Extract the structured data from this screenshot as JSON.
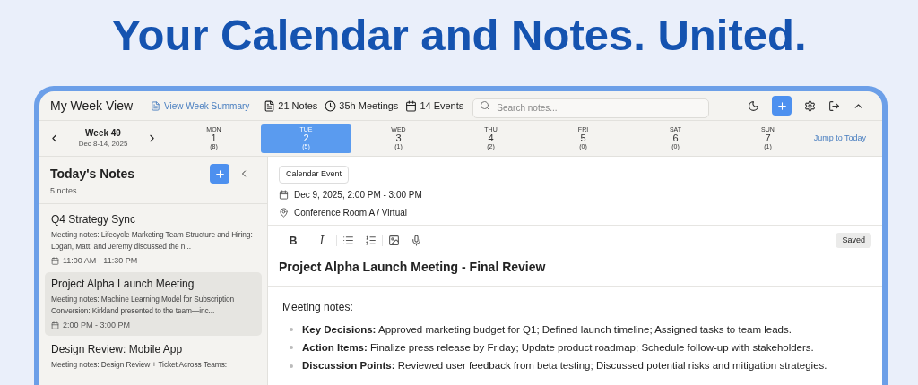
{
  "headline": "Your Calendar and Notes. United.",
  "window": {
    "title": "My Week View",
    "summary_link": "View Week Summary",
    "stats": [
      {
        "kind": "notes",
        "text": "21 Notes"
      },
      {
        "kind": "clock",
        "text": "35h Meetings"
      },
      {
        "kind": "calendar",
        "text": "14 Events"
      }
    ],
    "search": {
      "placeholder": "Search notes..."
    }
  },
  "week": {
    "label": "Week 49",
    "range": "Dec 8-14, 2025",
    "jump": "Jump to Today",
    "days": [
      {
        "dow": "MON",
        "date": "1",
        "count": "(8)",
        "selected": false
      },
      {
        "dow": "TUE",
        "date": "2",
        "count": "(5)",
        "selected": true
      },
      {
        "dow": "WED",
        "date": "3",
        "count": "(1)",
        "selected": false
      },
      {
        "dow": "THU",
        "date": "4",
        "count": "(2)",
        "selected": false
      },
      {
        "dow": "FRI",
        "date": "5",
        "count": "(0)",
        "selected": false
      },
      {
        "dow": "SAT",
        "date": "6",
        "count": "(0)",
        "selected": false
      },
      {
        "dow": "SUN",
        "date": "7",
        "count": "(1)",
        "selected": false
      }
    ]
  },
  "sidebar": {
    "title": "Today's Notes",
    "count": "5 notes",
    "notes": [
      {
        "title": "Q4 Strategy Sync",
        "preview": "Meeting notes: Lifecycle Marketing Team Structure and Hiring: Logan, Matt, and Jeremy discussed the n...",
        "time": "11:00 AM - 11:30 PM",
        "selected": false
      },
      {
        "title": "Project Alpha Launch Meeting",
        "preview": "Meeting notes: Machine Learning Model for Subscription Conversion: Kirkland presented to the team—inc...",
        "time": "2:00 PM - 3:00 PM",
        "selected": true
      },
      {
        "title": "Design Review: Mobile App",
        "preview": "Meeting notes: Design Review + Ticket Across Teams:",
        "selected": false
      }
    ]
  },
  "editor": {
    "badge": "Calendar Event",
    "date": "Dec 9, 2025, 2:00 PM - 3:00 PM",
    "location": "Conference Room A / Virtual",
    "toolbar": [
      [
        {
          "kind": "bold",
          "label": "B"
        },
        {
          "kind": "italic",
          "label": "I"
        }
      ],
      [
        {
          "kind": "bullets"
        },
        {
          "kind": "numbers"
        }
      ],
      [
        {
          "kind": "image"
        },
        {
          "kind": "mic"
        }
      ]
    ],
    "status": "Saved",
    "title": "Project Alpha Launch Meeting - Final Review",
    "intro": "Meeting notes:",
    "bullets": [
      "**Key Decisions:** Approved marketing budget for Q1; Defined launch timeline; Assigned tasks to team leads.",
      "**Action Items:** Finalize press release by Friday; Update product roadmap; Schedule follow-up with stakeholders.",
      "**Discussion Points:** Reviewed user feedback from beta testing; Discussed potential risks and mitigation strategies."
    ]
  }
}
